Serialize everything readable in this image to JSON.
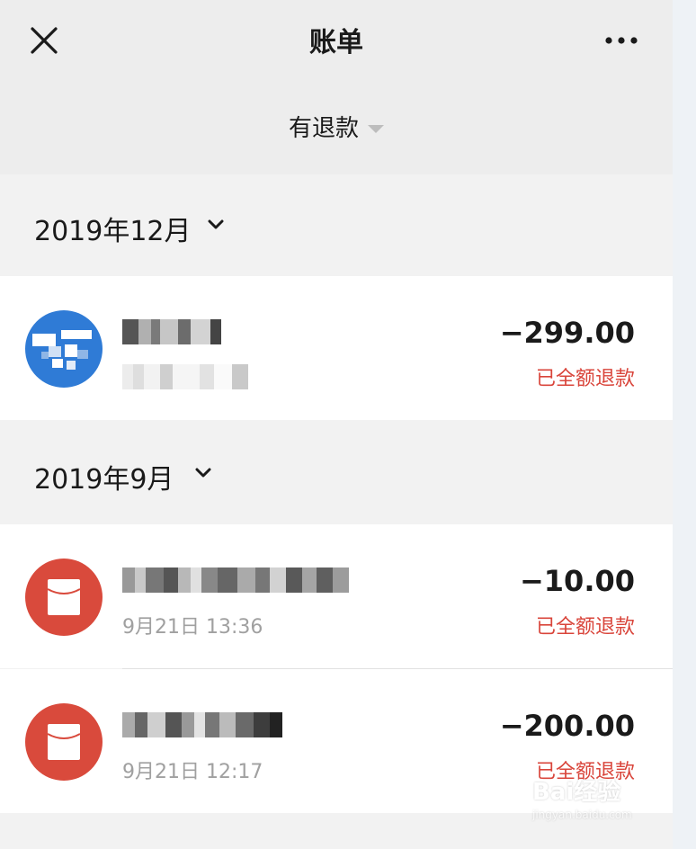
{
  "header": {
    "title": "账单"
  },
  "filter": {
    "label": "有退款"
  },
  "groups": [
    {
      "month": "2019年12月",
      "items": [
        {
          "amount": "−299.00",
          "status": "已全额退款",
          "subtitle": ""
        }
      ]
    },
    {
      "month": "2019年9月",
      "items": [
        {
          "amount": "−10.00",
          "status": "已全额退款",
          "subtitle": "9月21日 13:36"
        },
        {
          "amount": "−200.00",
          "status": "已全额退款",
          "subtitle": "9月21日 12:17"
        }
      ]
    }
  ],
  "watermark": {
    "logo": "Bai经验",
    "url": "jingyan.baidu.com"
  },
  "colors": {
    "refund_red": "#d9453b",
    "redpacket_red": "#d94a3c",
    "avatar_blue": "#2f7bd6"
  }
}
